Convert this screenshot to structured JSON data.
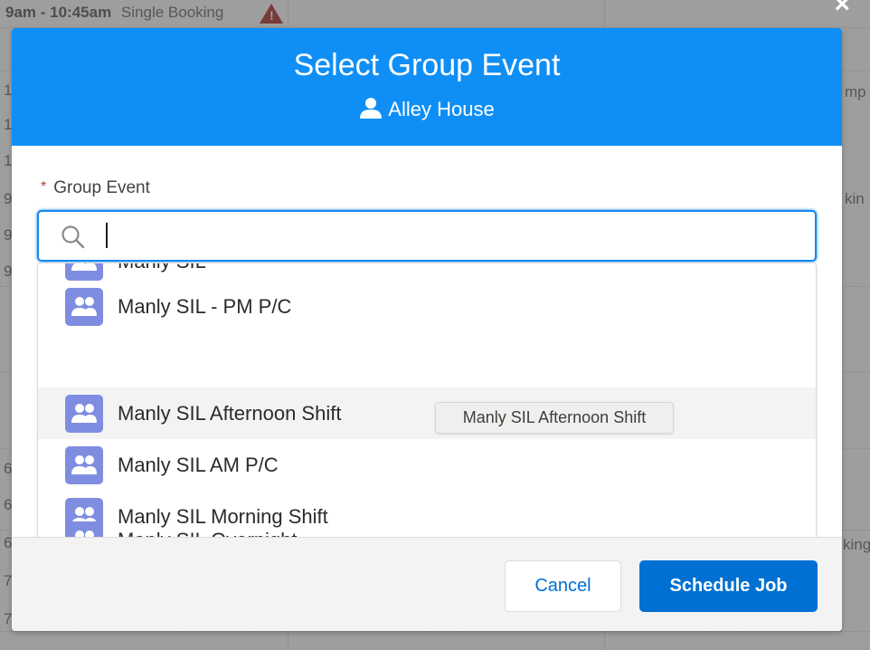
{
  "background": {
    "booking_time": "9am - 10:45am",
    "booking_type": "Single Booking",
    "warning_icon": "warning-icon",
    "left_digits": [
      "1",
      "1",
      "1",
      "9",
      "9",
      "9",
      "6",
      "6",
      "6",
      "7",
      "7"
    ],
    "right_fragments": [
      "mp",
      "kin",
      "king"
    ]
  },
  "modal": {
    "title": "Select Group Event",
    "subtitle": "Alley House",
    "subtitle_icon": "person-icon",
    "header_color": "#0f8ff5"
  },
  "field": {
    "required_marker": "*",
    "label": "Group Event",
    "value": "",
    "icon": "search-icon"
  },
  "dropdown": {
    "options": [
      {
        "label": "Manly SIL",
        "icon": "group-icon"
      },
      {
        "label": "Manly SIL - PM P/C",
        "icon": "group-icon"
      },
      {
        "label": "Manly SIL Afternoon Shift",
        "icon": "group-icon"
      },
      {
        "label": "Manly SIL AM P/C",
        "icon": "group-icon"
      },
      {
        "label": "Manly SIL Morning Shift",
        "icon": "group-icon"
      },
      {
        "label": "Manly SIL Overnight",
        "icon": "group-icon"
      }
    ],
    "tooltip": "Manly SIL Afternoon Shift"
  },
  "footer": {
    "cancel_label": "Cancel",
    "primary_label": "Schedule Job",
    "primary_color": "#0070d2"
  }
}
